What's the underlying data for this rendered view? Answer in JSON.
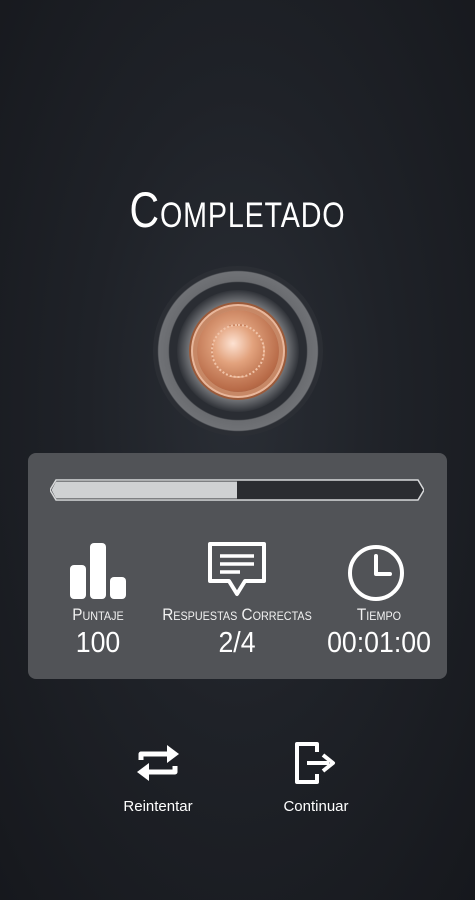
{
  "title": "Completado",
  "progress": {
    "fraction": 0.5
  },
  "stats": {
    "score": {
      "label": "Puntaje",
      "value": "100",
      "icon": "bar-chart-icon"
    },
    "correct": {
      "label": "Respuestas Correctas",
      "value": "2/4",
      "icon": "chat-message-icon"
    },
    "time": {
      "label": "Tiempo",
      "value": "00:01:00",
      "icon": "clock-icon"
    }
  },
  "actions": {
    "retry": {
      "label": "Reintentar",
      "icon": "repeat-icon"
    },
    "continue": {
      "label": "Continuar",
      "icon": "exit-icon"
    }
  },
  "colors": {
    "background": "#1f2228",
    "panel": "#515357",
    "progress_fill": "#cfd1d3",
    "progress_track": "#2b2d31",
    "medal": "#d99874"
  }
}
